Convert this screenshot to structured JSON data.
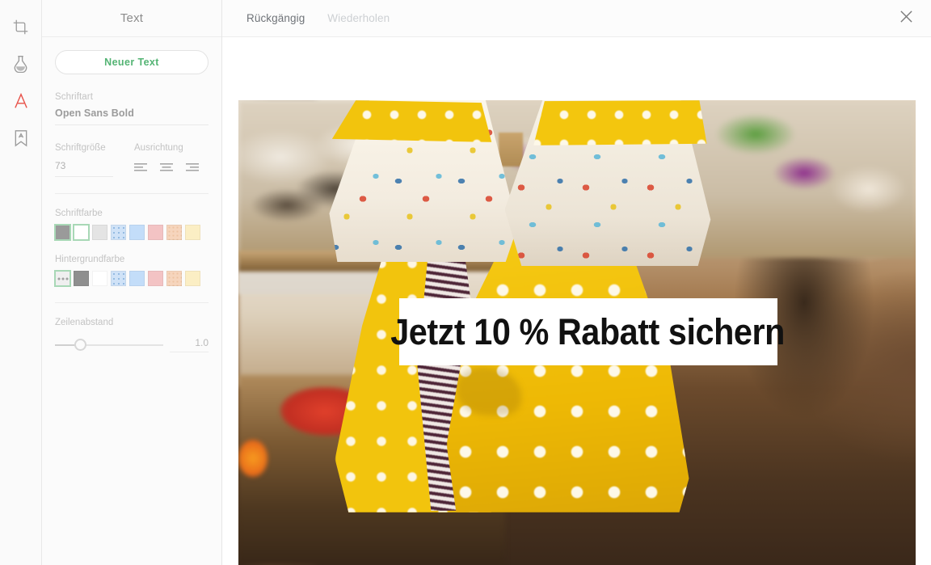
{
  "rail": {
    "items": [
      {
        "name": "crop-icon",
        "label": "Zuschneiden",
        "active": false
      },
      {
        "name": "filter-flask-icon",
        "label": "Filter",
        "active": false
      },
      {
        "name": "text-a-icon",
        "label": "Text",
        "active": true
      },
      {
        "name": "sticker-bookmark-icon",
        "label": "Sticker",
        "active": false
      }
    ],
    "active_color": "#e8534a"
  },
  "panel": {
    "title": "Text",
    "new_text_button": "Neuer Text",
    "font_family_label": "Schriftart",
    "font_family_value": "Open Sans Bold",
    "font_size_label": "Schriftgröße",
    "font_size_value": "73",
    "alignment_label": "Ausrichtung",
    "alignment_options": [
      "align-left",
      "align-center",
      "align-right"
    ],
    "font_color_label": "Schriftfarbe",
    "font_colors": [
      {
        "name": "gray",
        "hex": "#9a9a9a",
        "selected": false
      },
      {
        "name": "white",
        "hex": "#ffffff",
        "selected": true
      },
      {
        "name": "light-gray",
        "hex": "#e4e4e4",
        "selected": false
      },
      {
        "name": "pale-blue-pattern",
        "hex": "#cfe2f7",
        "selected": false
      },
      {
        "name": "light-blue",
        "hex": "#c3ddf9",
        "selected": false
      },
      {
        "name": "pink",
        "hex": "#f3c3c4",
        "selected": false
      },
      {
        "name": "peach",
        "hex": "#f6d5bd",
        "selected": false
      },
      {
        "name": "cream",
        "hex": "#fbeec4",
        "selected": false
      }
    ],
    "bg_color_label": "Hintergrundfarbe",
    "bg_colors": [
      {
        "name": "transparent",
        "hex": "transparent",
        "selected": true
      },
      {
        "name": "gray",
        "hex": "#8f8f8f",
        "selected": false
      },
      {
        "name": "white",
        "hex": "#ffffff",
        "selected": false
      },
      {
        "name": "pale-blue-pattern",
        "hex": "#cfe2f7",
        "selected": false
      },
      {
        "name": "light-blue",
        "hex": "#c3ddf9",
        "selected": false
      },
      {
        "name": "pink",
        "hex": "#f3c3c4",
        "selected": false
      },
      {
        "name": "peach",
        "hex": "#f6d5bd",
        "selected": false
      },
      {
        "name": "cream",
        "hex": "#fbeec4",
        "selected": false
      }
    ],
    "line_height_label": "Zeilenabstand",
    "line_height_value": "1.0",
    "accent_color": "#54b474"
  },
  "topbar": {
    "undo_label": "Rückgängig",
    "redo_label": "Wiederholen",
    "close_icon": "close-icon"
  },
  "canvas": {
    "overlay_text": "Jetzt 10 % Rabatt sichern",
    "photo_description": "Kinderbekleidungsgeschäft mit gelben Punktekleidern und Schuhen"
  }
}
